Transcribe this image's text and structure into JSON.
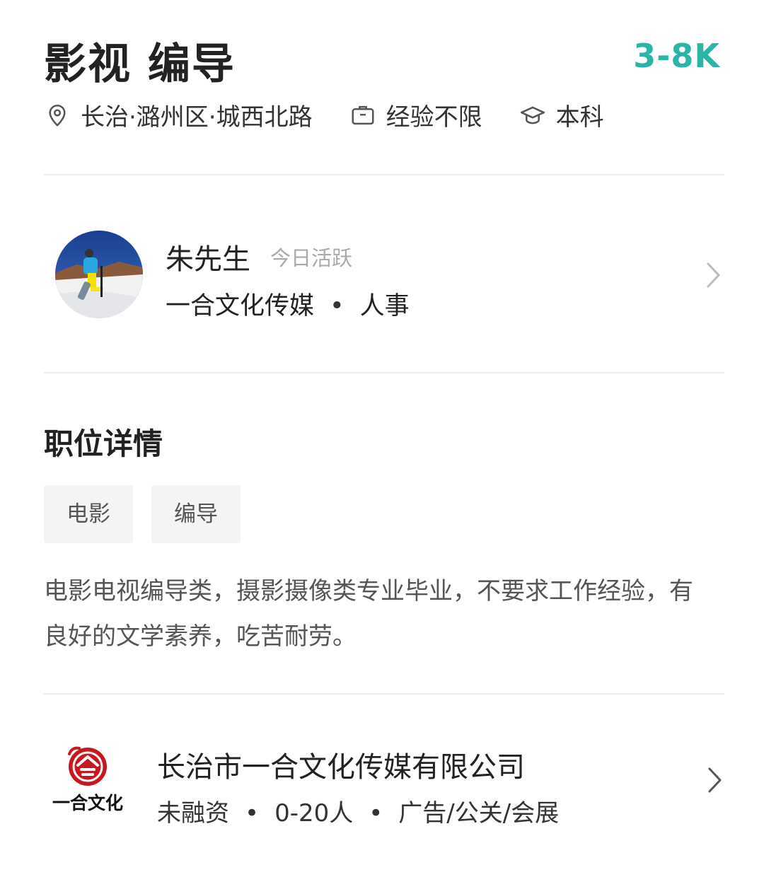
{
  "job": {
    "title": "影视  编导",
    "salary": "3-8K",
    "location": "长治·潞州区·城西北路",
    "experience": "经验不限",
    "education": "本科"
  },
  "recruiter": {
    "name": "朱先生",
    "status": "今日活跃",
    "company": "一合文化传媒",
    "role": "人事"
  },
  "detail": {
    "section_title": "职位详情",
    "tags": [
      "电影",
      "编导"
    ],
    "description": "电影电视编导类，摄影摄像类专业毕业，不要求工作经验，有良好的文学素养，吃苦耐劳。"
  },
  "company": {
    "name": "长治市一合文化传媒有限公司",
    "funding": "未融资",
    "size": "0-20人",
    "industry": "广告/公关/会展",
    "logo_text": "一合文化"
  },
  "colors": {
    "accent": "#2bb5a9",
    "text": "#222222",
    "muted": "#aaaaaa"
  }
}
